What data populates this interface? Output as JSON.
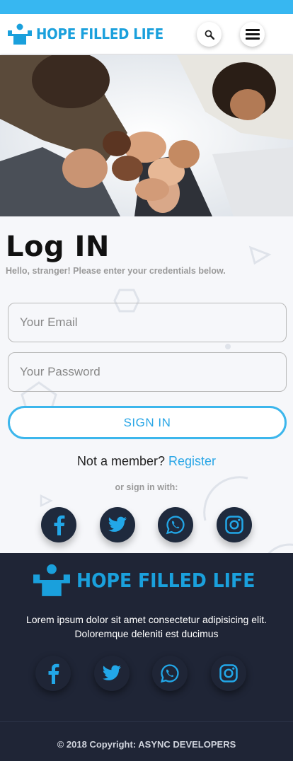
{
  "brand": {
    "name": "HOPE FILLED LIFE",
    "color": "#1aa0dc",
    "logo_icon": "person-raised-arms-icon"
  },
  "navbar": {
    "search_icon": "search-icon",
    "menu_icon": "hamburger-menu-icon"
  },
  "hero": {
    "image": "group-fist-bump-photo"
  },
  "login": {
    "title": "Log IN",
    "subtitle": "Hello, stranger! Please enter your credentials below.",
    "email_placeholder": "Your Email",
    "password_placeholder": "Your Password",
    "signin_label": "SIGN IN",
    "not_member_text": "Not a member?",
    "register_label": "Register",
    "or_sign_in": "or sign in with:"
  },
  "social": [
    {
      "name": "facebook",
      "icon": "facebook-icon"
    },
    {
      "name": "twitter",
      "icon": "twitter-icon"
    },
    {
      "name": "whatsapp",
      "icon": "whatsapp-icon"
    },
    {
      "name": "instagram",
      "icon": "instagram-icon"
    }
  ],
  "footer": {
    "brand_name": "HOPE FILLED LIFE",
    "description": "Lorem ipsum dolor sit amet consectetur adipisicing elit. Doloremque deleniti est ducimus",
    "copyright": "© 2018 Copyright: ASYNC DEVELOPERS"
  },
  "colors": {
    "accent": "#37b7f1",
    "link": "#2aa6e6",
    "dark": "#1f2536",
    "social_bg": "#1f2a3d"
  }
}
